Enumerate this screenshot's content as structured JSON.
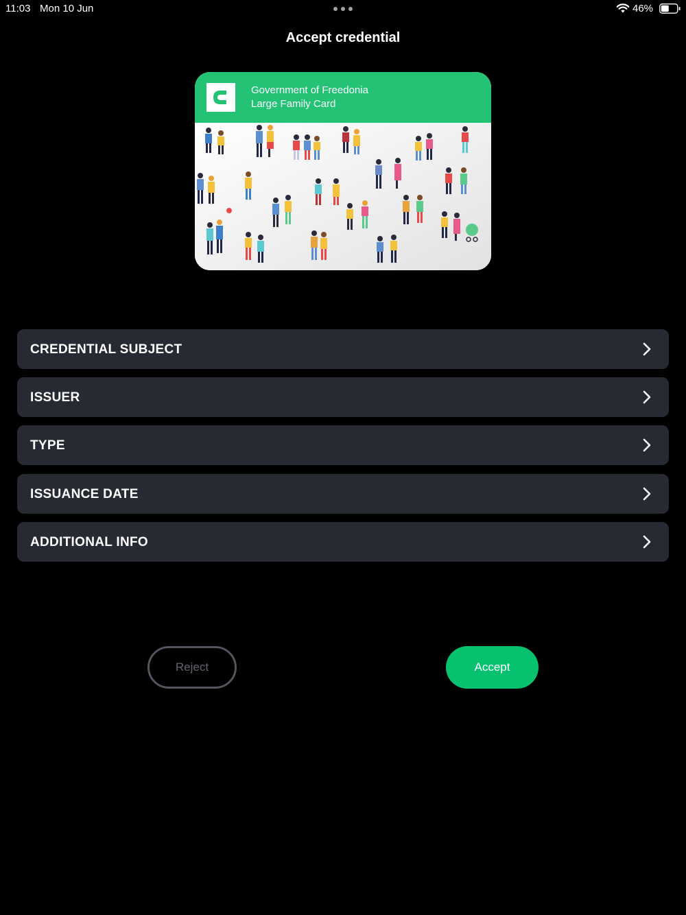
{
  "status_bar": {
    "time": "11:03",
    "date": "Mon 10 Jun",
    "battery": "46%",
    "icons": [
      "more-dots-icon",
      "wifi-icon",
      "battery-icon"
    ]
  },
  "header": {
    "title": "Accept credential"
  },
  "card": {
    "issuer": "Government of Freedonia",
    "type": "Large Family Card",
    "header_color": "#23c274",
    "logo_icon": "credential-logo-icon"
  },
  "sections": [
    {
      "label": "CREDENTIAL SUBJECT"
    },
    {
      "label": "ISSUER"
    },
    {
      "label": "TYPE"
    },
    {
      "label": "ISSUANCE DATE"
    },
    {
      "label": "ADDITIONAL INFO"
    }
  ],
  "actions": {
    "reject_label": "Reject",
    "accept_label": "Accept",
    "accent_color": "#06c26f"
  }
}
